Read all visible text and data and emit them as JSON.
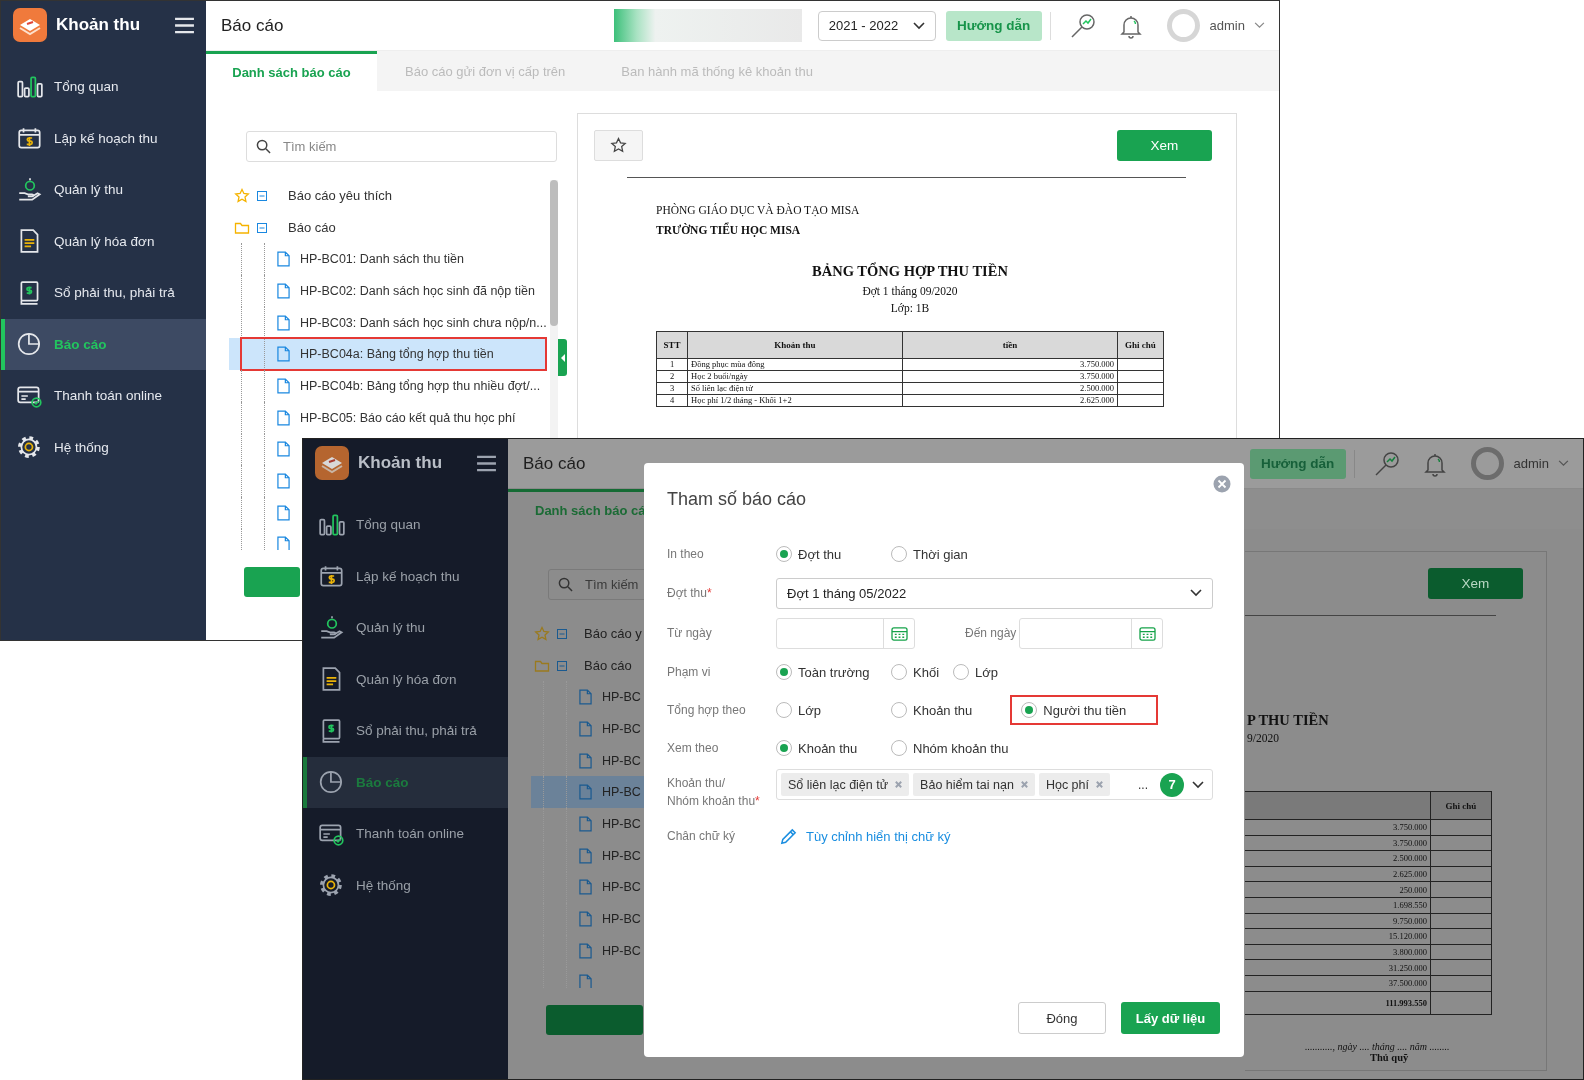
{
  "back_screen": {
    "app_title": "Khoản thu",
    "sidebar": [
      {
        "label": "Tổng quan",
        "selected": false
      },
      {
        "label": "Lập kế hoạch thu",
        "selected": false
      },
      {
        "label": "Quản lý thu",
        "selected": false
      },
      {
        "label": "Quản lý hóa đơn",
        "selected": false
      },
      {
        "label": "Sổ phải thu, phải trả",
        "selected": false
      },
      {
        "label": "Báo cáo",
        "selected": true
      },
      {
        "label": "Thanh toán online",
        "selected": false
      },
      {
        "label": "Hệ thống",
        "selected": false
      }
    ],
    "page_title": "Báo cáo",
    "year": "2021 - 2022",
    "guide_button": "Hướng dẫn",
    "user": "admin",
    "tabs": [
      {
        "label": "Danh sách báo cáo",
        "selected": true
      },
      {
        "label": "Báo cáo gửi đơn vị cấp trên",
        "selected": false
      },
      {
        "label": "Ban hành mã thống kê khoản thu",
        "selected": false
      }
    ],
    "search": {
      "placeholder": "Tìm kiếm"
    },
    "tree": [
      {
        "label": "Báo cáo yêu thích",
        "kind": "favorites",
        "expanded": true
      },
      {
        "label": "Báo cáo",
        "kind": "folder",
        "expanded": true,
        "children": [
          {
            "label": "HP-BC01: Danh sách thu tiền",
            "selected": false,
            "highlighted": false
          },
          {
            "label": "HP-BC02: Danh sách học sinh đã nộp tiền",
            "selected": false,
            "highlighted": false
          },
          {
            "label": "HP-BC03: Danh sách học sinh chưa nộp/n...",
            "selected": false,
            "highlighted": false
          },
          {
            "label": "HP-BC04a: Bảng tổng hợp thu tiền",
            "selected": true,
            "highlighted": true
          },
          {
            "label": "HP-BC04b: Bảng tổng hợp thu nhiều đợt/...",
            "selected": false,
            "highlighted": false
          },
          {
            "label": "HP-BC05: Báo cáo kết quả thu học phí",
            "selected": false,
            "highlighted": false
          },
          {
            "selected": false,
            "highlighted": false
          },
          {
            "selected": false,
            "highlighted": false
          },
          {
            "selected": false,
            "highlighted": false
          },
          {
            "selected": false,
            "highlighted": false
          }
        ]
      }
    ],
    "report": {
      "view_button": "Xem",
      "org_lines": [
        "PHÒNG GIÁO DỤC VÀ ĐÀO TẠO MISA",
        "TRƯỜNG TIỂU HỌC MISA"
      ],
      "title": "BẢNG TỔNG HỢP THU TIỀN",
      "sub_lines": [
        "Đợt 1 tháng 09/2020",
        "Lớp: 1B"
      ],
      "columns": [
        "STT",
        "Khoản thu",
        "tiền",
        "Ghi chú"
      ],
      "rows": [
        [
          "1",
          "Đồng phục mùa đông",
          "3.750.000"
        ],
        [
          "2",
          "Học 2 buổi/ngày",
          "3.750.000"
        ],
        [
          "3",
          "Sổ liên lạc điện tử",
          "2.500.000"
        ],
        [
          "4",
          "Học phí 1/2 tháng - Khối 1+2",
          "2.625.000"
        ]
      ]
    }
  },
  "front_screen": {
    "app_title": "Khoản thu",
    "sidebar": [
      {
        "label": "Tổng quan",
        "selected": false
      },
      {
        "label": "Lập kế hoạch thu",
        "selected": false
      },
      {
        "label": "Quản lý thu",
        "selected": false
      },
      {
        "label": "Quản lý hóa đơn",
        "selected": false
      },
      {
        "label": "Sổ phải thu, phải trả",
        "selected": false
      },
      {
        "label": "Báo cáo",
        "selected": true
      },
      {
        "label": "Thanh toán online",
        "selected": false
      },
      {
        "label": "Hệ thống",
        "selected": false
      }
    ],
    "page_title": "Báo cáo",
    "guide_button": "Hướng dẫn",
    "user": "admin",
    "tabs": [
      {
        "label": "Danh sách báo cá",
        "selected": true
      }
    ],
    "search": {
      "placeholder": "Tìm kiếm"
    },
    "tree": [
      {
        "label": "Báo cáo y",
        "kind": "favorites",
        "expanded": true
      },
      {
        "label": "Báo cáo",
        "kind": "folder",
        "expanded": true,
        "children": [
          {
            "label": "HP-BC",
            "selected": false
          },
          {
            "label": "HP-BC",
            "selected": false
          },
          {
            "label": "HP-BC",
            "selected": false
          },
          {
            "label": "HP-BC",
            "selected": true
          },
          {
            "label": "HP-BC",
            "selected": false
          },
          {
            "label": "HP-BC",
            "selected": false
          },
          {
            "label": "HP-BC",
            "selected": false
          },
          {
            "label": "HP-BC",
            "selected": false
          },
          {
            "label": "HP-BC",
            "selected": false
          },
          {
            "selected": false
          }
        ]
      }
    ],
    "report": {
      "view_button": "Xem",
      "title": "P THU TIỀN",
      "sub_line": "9/2020",
      "note_column": "Ghi chú",
      "amounts": [
        "3.750.000",
        "3.750.000",
        "2.500.000",
        "2.625.000",
        "250.000",
        "1.698.550",
        "9.750.000",
        "15.120.000",
        "3.800.000",
        "31.250.000",
        "37.500.000"
      ],
      "total": "111.993.550",
      "date_line": "..........., ngày .... tháng .... năm ........",
      "signer": "Thủ quỹ"
    },
    "dialog": {
      "title": "Tham số báo cáo",
      "fields": [
        {
          "kind": "radio",
          "label": "In theo",
          "options": [
            {
              "label": "Đợt thu",
              "selected": true,
              "highlighted": false
            },
            {
              "label": "Thời gian",
              "selected": false,
              "highlighted": false
            }
          ]
        },
        {
          "kind": "select",
          "label": "Đợt thu",
          "required_mark": "*",
          "value": "Đợt 1 tháng 05/2022"
        },
        {
          "kind": "date_range",
          "label": "Từ ngày",
          "end_label": "Đến ngày"
        },
        {
          "kind": "radio",
          "label": "Phạm vi",
          "options": [
            {
              "label": "Toàn trường",
              "selected": true,
              "highlighted": false
            },
            {
              "label": "Khối",
              "selected": false,
              "highlighted": false
            },
            {
              "label": "Lớp",
              "selected": false,
              "highlighted": false
            }
          ]
        },
        {
          "kind": "radio",
          "label": "Tổng hợp theo",
          "options": [
            {
              "label": "Lớp",
              "selected": false,
              "highlighted": false
            },
            {
              "label": "Khoản thu",
              "selected": false,
              "highlighted": false
            },
            {
              "label": "Người thu tiền",
              "selected": true,
              "highlighted": true
            }
          ]
        },
        {
          "kind": "radio",
          "label": "Xem theo",
          "options": [
            {
              "label": "Khoản thu",
              "selected": true,
              "highlighted": false
            },
            {
              "label": "Nhóm khoản thu",
              "selected": false,
              "highlighted": false
            }
          ]
        },
        {
          "kind": "tags",
          "label": "Khoản thu/\nNhóm khoản thu",
          "required_mark": "*",
          "tags": [
            "Sổ liên lạc điện tử",
            "Bảo hiểm tai nạn",
            "Học phí"
          ],
          "more": "...",
          "count": "7"
        },
        {
          "kind": "link",
          "label": "Chân chữ ký",
          "value": "Tùy chỉnh hiển thị chữ ký"
        }
      ],
      "close_button": "Đóng",
      "submit_button": "Lấy dữ liệu"
    }
  }
}
